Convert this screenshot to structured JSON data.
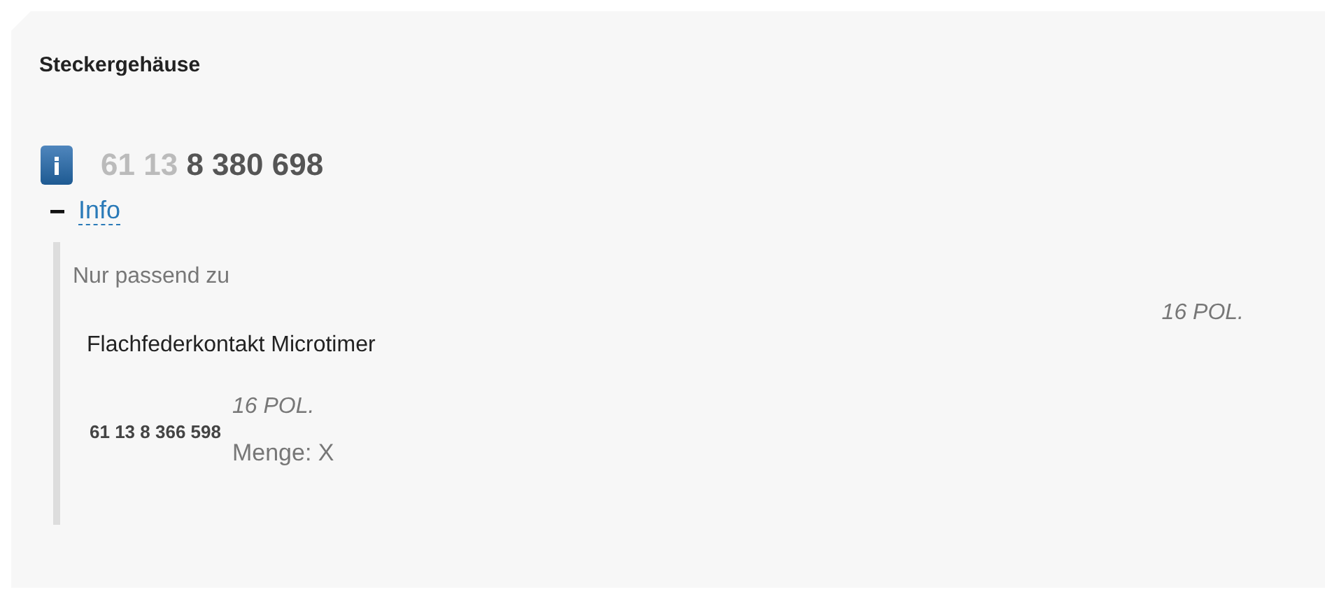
{
  "panel": {
    "title": "Steckergehäuse"
  },
  "part": {
    "prefix": "61 13",
    "number": "8 380 698"
  },
  "info": {
    "label": "Info",
    "expanded": true,
    "heading": "Nur passend zu",
    "match": {
      "name": "Flachfederkontakt Microtimer",
      "spec": "16 POL."
    },
    "items": [
      {
        "number": "61 13 8 366 598",
        "spec": "16 POL.",
        "quantity": "Menge: X"
      }
    ]
  }
}
